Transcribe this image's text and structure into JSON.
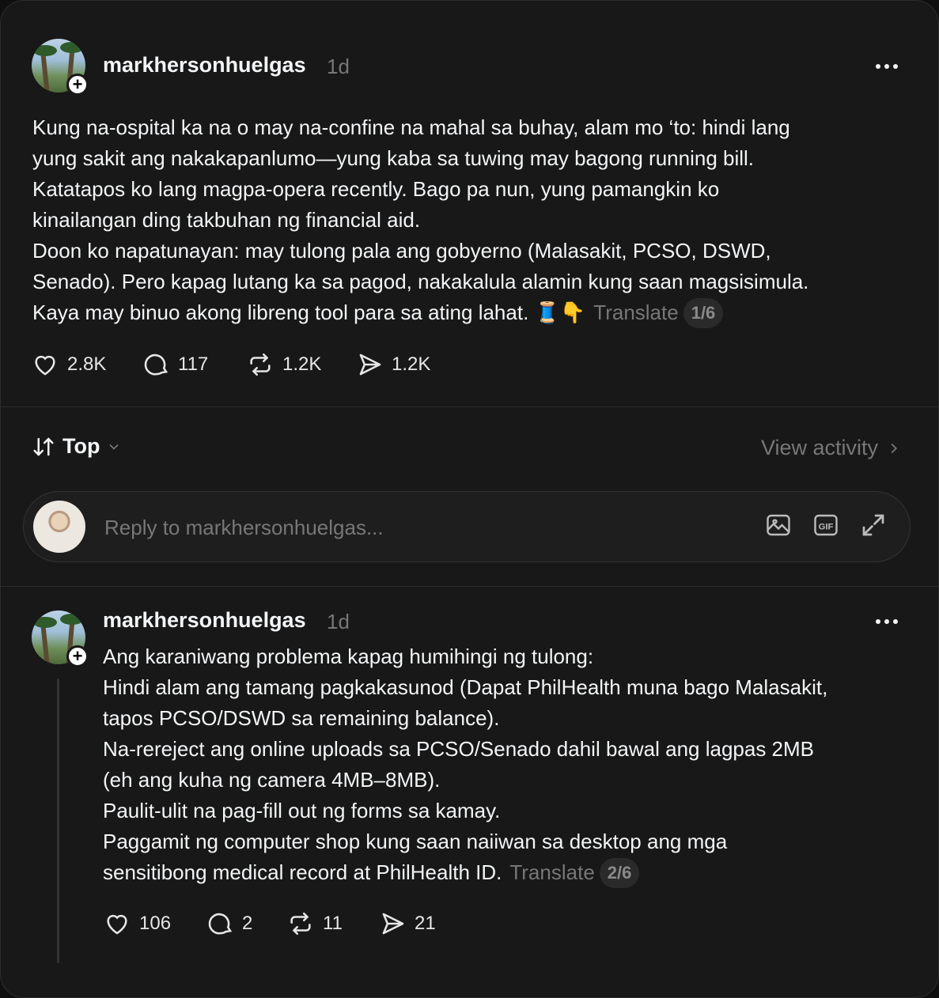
{
  "post": {
    "username": "markhersonhuelgas",
    "time": "1d",
    "lines": [
      "Kung na-ospital ka na o may na-confine na mahal sa buhay, alam mo ‘to: hindi lang",
      "yung sakit ang nakakapanlumo—yung kaba sa tuwing may bagong running bill.",
      "Katatapos ko lang magpa-opera recently. Bago pa nun, yung pamangkin ko",
      "kinailangan ding takbuhan ng financial aid.",
      "Doon ko napatunayan: may tulong pala ang gobyerno (Malasakit, PCSO, DSWD,",
      "Senado). Pero kapag lutang ka sa pagod, nakakalula alamin kung saan magsisimula.",
      "Kaya may binuo akong libreng tool para sa ating lahat. 🧵👇"
    ],
    "translate": "Translate",
    "pager": "1/6",
    "likes": "2.8K",
    "comments": "117",
    "reposts": "1.2K",
    "shares": "1.2K"
  },
  "sort": {
    "label": "Top",
    "view_activity": "View activity"
  },
  "reply": {
    "placeholder": "Reply to markhersonhuelgas..."
  },
  "thread_post": {
    "username": "markhersonhuelgas",
    "time": "1d",
    "lines": [
      "Ang karaniwang problema kapag humihingi ng tulong:",
      "Hindi alam ang tamang pagkakasunod (Dapat PhilHealth muna bago Malasakit,",
      "tapos PCSO/DSWD sa remaining balance).",
      "Na-rereject ang online uploads sa PCSO/Senado dahil bawal ang lagpas 2MB",
      "(eh ang kuha ng camera 4MB–8MB).",
      "Paulit-ulit na pag-fill out ng forms sa kamay.",
      "Paggamit ng computer shop kung saan naiiwan sa desktop ang mga",
      "sensitibong medical record at PhilHealth ID."
    ],
    "translate": "Translate",
    "pager": "2/6",
    "likes": "106",
    "comments": "2",
    "reposts": "11",
    "shares": "21"
  },
  "icons": {
    "more": "more-horizontal-icon",
    "like": "heart-icon",
    "comment": "comment-bubble-icon",
    "repost": "repost-icon",
    "share": "send-icon",
    "sort": "sort-arrows-icon",
    "chevron": "chevron-down-icon",
    "arrow": "chevron-right-icon",
    "image": "image-icon",
    "gif": "gif-icon",
    "expand": "expand-icon"
  },
  "colors": {
    "background": "#181818",
    "text": "#f3f5f7",
    "muted": "#777777"
  }
}
